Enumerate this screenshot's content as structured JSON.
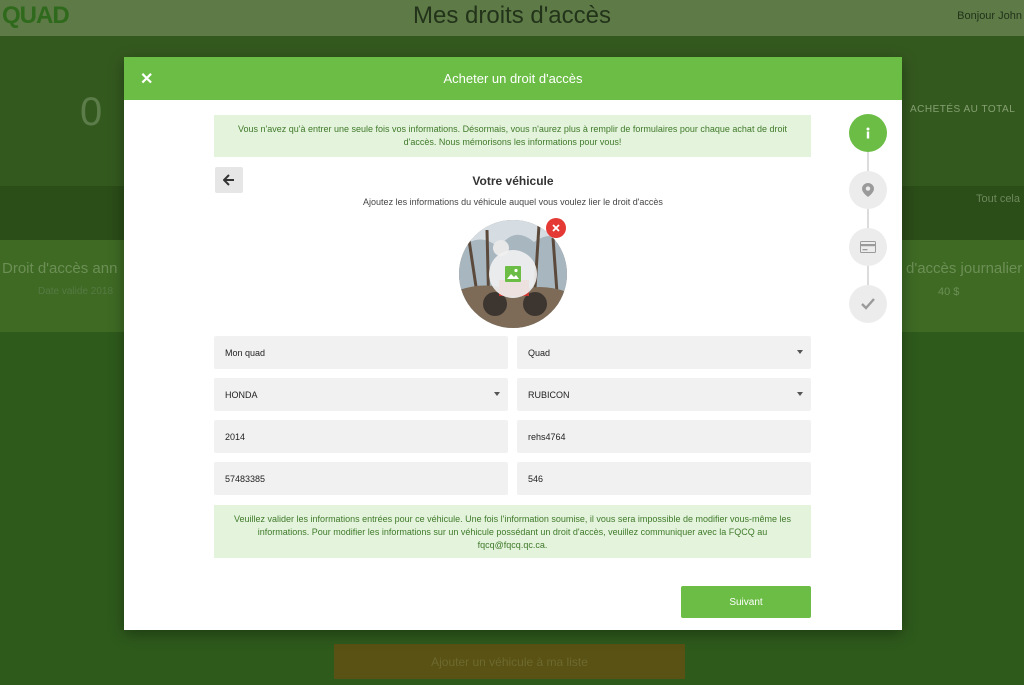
{
  "background": {
    "logo": "QUAD",
    "page_title": "Mes droits d'accès",
    "greeting": "Bonjour John",
    "big_number": "0",
    "total_label": "ACHETÉS AU TOTAL",
    "band_link": "Tout cela",
    "card_left_title": "Droit d'accès ann",
    "card_left_sub": "Date valide 2018",
    "card_right_title": "d'accès journalier",
    "card_right_sub": "40 $",
    "add_vehicle_button": "Ajouter un véhicule à ma liste"
  },
  "modal": {
    "title": "Acheter un droit d'accès",
    "top_notice": "Vous n'avez qu'à entrer une seule fois vos informations. Désormais, vous n'aurez plus à remplir de formulaires pour chaque achat de droit d'accès. Nous mémorisons les informations pour vous!",
    "section_title": "Votre véhicule",
    "section_subtitle": "Ajoutez les informations du véhicule auquel vous voulez lier le droit d'accès",
    "fields": {
      "name": "Mon quad",
      "type": "Quad",
      "make": "HONDA",
      "model": "RUBICON",
      "year": "2014",
      "plate": "rehs4764",
      "serial": "57483385",
      "number": "546"
    },
    "bottom_notice": "Veuillez valider les informations entrées pour ce véhicule. Une fois l'information soumise, il vous sera impossible de modifier vous-même les informations. Pour modifier les informations sur un véhicule possédant un droit d'accès, veuillez communiquer avec la FQCQ au fqcq@fqcq.qc.ca.",
    "submit_label": "Suivant"
  },
  "stepper": {
    "steps": [
      {
        "icon": "info-icon",
        "active": true
      },
      {
        "icon": "location-pin-icon",
        "active": false
      },
      {
        "icon": "credit-card-icon",
        "active": false
      },
      {
        "icon": "checkmark-icon",
        "active": false
      }
    ]
  },
  "colors": {
    "brand_green": "#6bbd45",
    "notice_bg": "#e4f3dc",
    "notice_text": "#3f7a2a",
    "remove_red": "#e53935"
  }
}
